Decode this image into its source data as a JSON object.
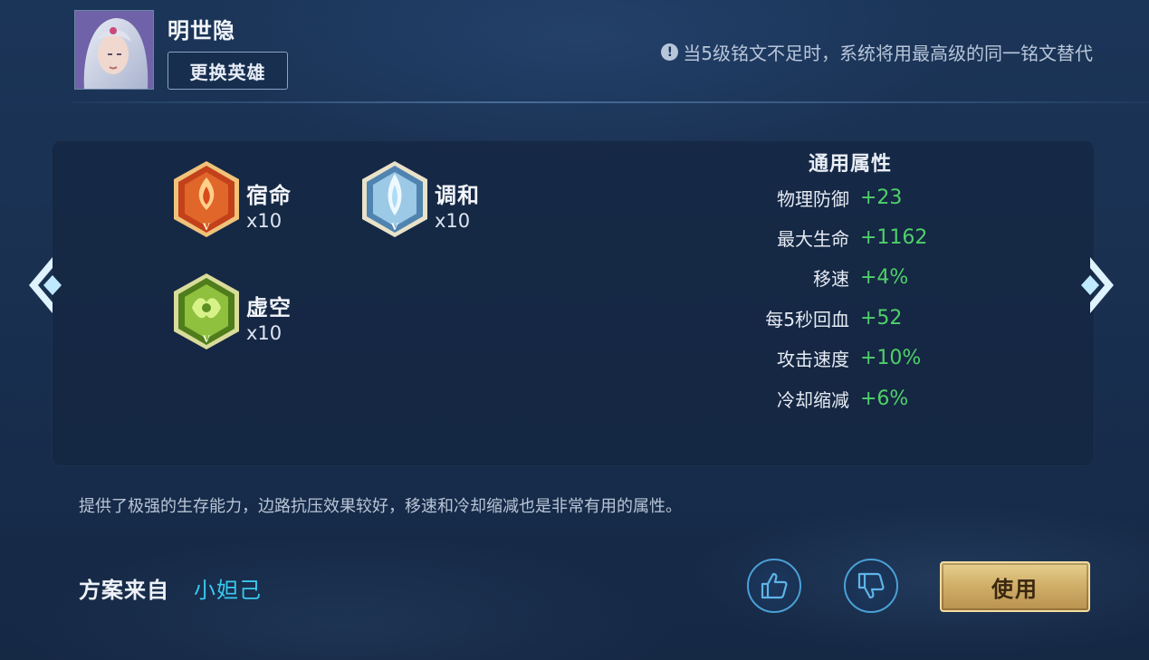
{
  "hero": {
    "name": "明世隐",
    "change_button": "更换英雄"
  },
  "notice": {
    "icon": "exclamation-circle-icon",
    "text": "当5级铭文不足时，系统将用最高级的同一铭文替代"
  },
  "runes": [
    {
      "name": "宿命",
      "count": "x10",
      "color": "#d9531e",
      "icon": "rune-red-icon"
    },
    {
      "name": "调和",
      "count": "x10",
      "color": "#8fc6e8",
      "icon": "rune-blue-icon"
    },
    {
      "name": "虚空",
      "count": "x10",
      "color": "#7fb83a",
      "icon": "rune-green-icon"
    }
  ],
  "attributes": {
    "title": "通用属性",
    "rows": [
      {
        "label": "物理防御",
        "value": "+23"
      },
      {
        "label": "最大生命",
        "value": "+1162"
      },
      {
        "label": "移速",
        "value": "+4%"
      },
      {
        "label": "每5秒回血",
        "value": "+52"
      },
      {
        "label": "攻击速度",
        "value": "+10%"
      },
      {
        "label": "冷却缩减",
        "value": "+6%"
      }
    ]
  },
  "description": "提供了极强的生存能力，边路抗压效果较好，移速和冷却缩减也是非常有用的属性。",
  "source": {
    "label": "方案来自",
    "author": "小妲己"
  },
  "actions": {
    "like_icon": "thumbs-up-icon",
    "dislike_icon": "thumbs-down-icon",
    "use_button": "使用"
  },
  "colors": {
    "accent_green": "#4fd06a",
    "author_cyan": "#39c8f0",
    "gold_button": "#d1b06a"
  }
}
